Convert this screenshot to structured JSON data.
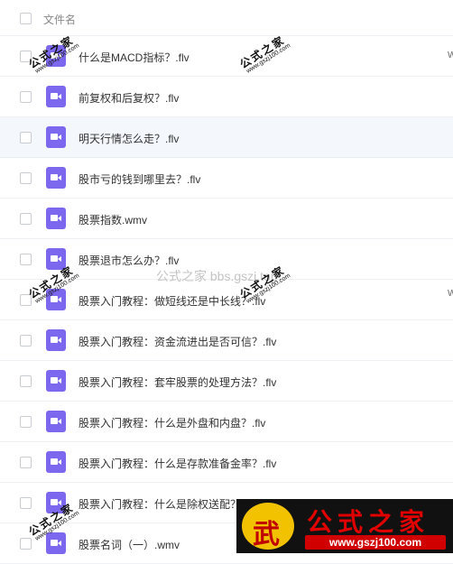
{
  "header": {
    "column_title": "文件名"
  },
  "files": [
    {
      "name": "什么是MACD指标？.flv"
    },
    {
      "name": "前复权和后复权？.flv"
    },
    {
      "name": "明天行情怎么走？.flv"
    },
    {
      "name": "股市亏的钱到哪里去？.flv"
    },
    {
      "name": "股票指数.wmv"
    },
    {
      "name": "股票退市怎么办？.flv"
    },
    {
      "name": "股票入门教程：做短线还是中长线？.flv"
    },
    {
      "name": "股票入门教程：资金流进出是否可信？.flv"
    },
    {
      "name": "股票入门教程：套牢股票的处理方法？.flv"
    },
    {
      "name": "股票入门教程：什么是外盘和内盘？.flv"
    },
    {
      "name": "股票入门教程：什么是存款准备金率？.flv"
    },
    {
      "name": "股票入门教程：什么是除权送配？.flv"
    },
    {
      "name": "股票名词（一）.wmv"
    }
  ],
  "selected_index": 2,
  "watermark": {
    "center_text": "公式之家 bbs.gszj.top",
    "stamp_text": "公式之家",
    "stamp_url": "www.gszj100.com",
    "edge_mark": "W"
  },
  "logo": {
    "badge_char": "武",
    "brand": "公式之家",
    "url": "www.gszj100.com"
  },
  "colors": {
    "file_icon": "#7b68ee",
    "selected_row": "#f4f7fb",
    "logo_red": "#e00000",
    "logo_badge": "#f2c200"
  },
  "icons": {
    "file": "video-file-icon",
    "checkbox": "checkbox-icon"
  }
}
